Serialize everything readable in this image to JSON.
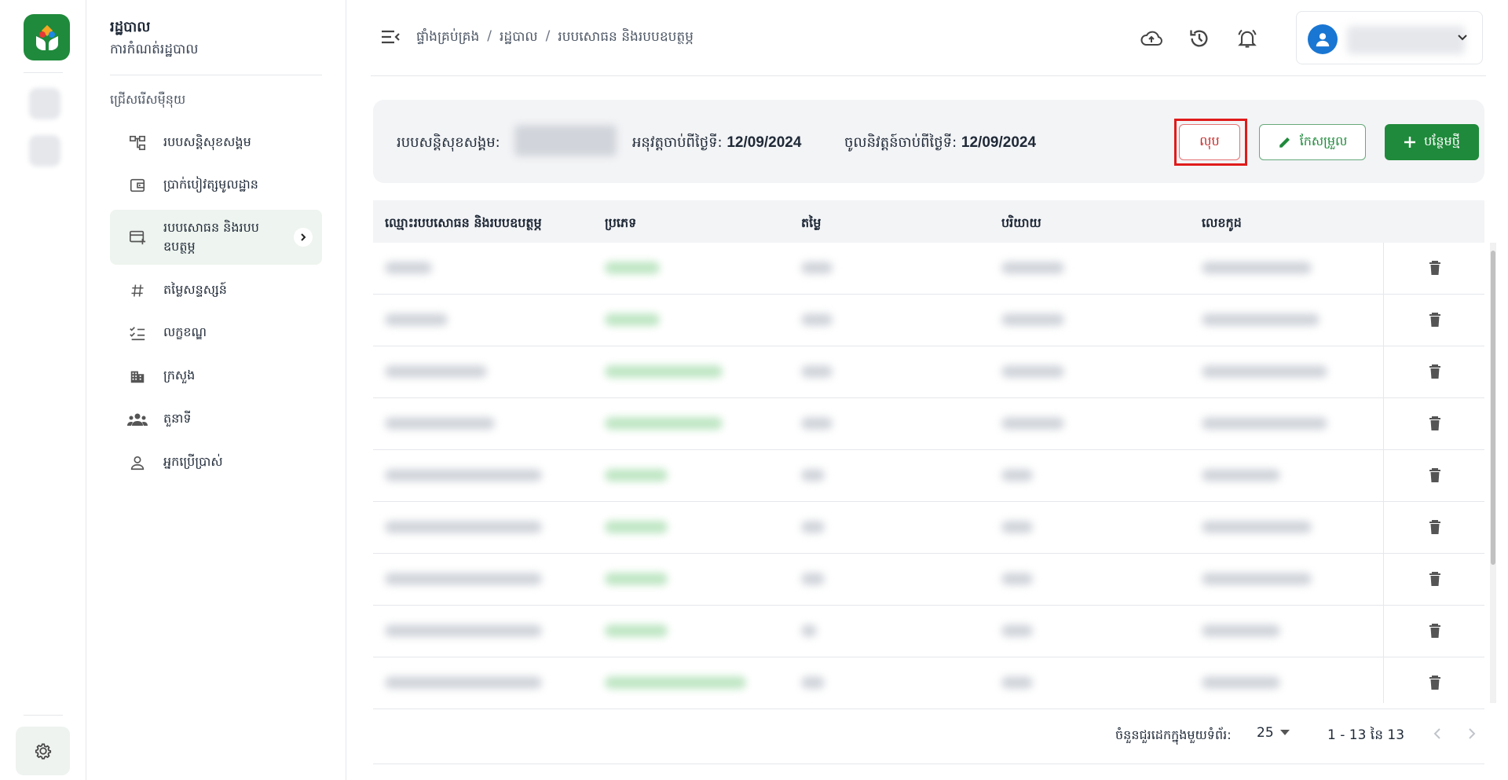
{
  "sidebar_menu": {
    "title": "រដ្ឋបាល",
    "subtitle": "ការកំណត់រដ្ឋបាល",
    "section_label": "ជ្រើសរើសម៉ឺនុយ",
    "items": [
      {
        "label": "របបសន្តិសុខសង្គម",
        "icon": "hierarchy-icon"
      },
      {
        "label": "ប្រាក់បៀវត្សមូលដ្ឋាន",
        "icon": "wallet-icon"
      },
      {
        "label": "របបសោធន និងរបបឧបត្ថម្ភ",
        "icon": "card-add-icon",
        "active": true
      },
      {
        "label": "តម្លៃសន្ទស្សន៍",
        "icon": "hash-icon"
      },
      {
        "label": "លក្ខខណ្ឌ",
        "icon": "checklist-icon"
      },
      {
        "label": "ក្រសួង",
        "icon": "building-icon"
      },
      {
        "label": "តួនាទី",
        "icon": "group-icon"
      },
      {
        "label": "អ្នកប្រើប្រាស់",
        "icon": "person-icon"
      }
    ]
  },
  "header": {
    "breadcrumb": [
      "ផ្ទាំងគ្រប់គ្រង",
      "រដ្ឋបាល",
      "របបសោធន និងរបបឧបត្ថម្ភ"
    ],
    "separator": "/",
    "icons": [
      "cloud-upload-icon",
      "history-icon",
      "bell-icon"
    ]
  },
  "info_bar": {
    "scheme_label": "របបសន្តិសុខសង្គម:",
    "effective_label": "អនុវត្តចាប់ពីថ្ងៃទី:",
    "effective_date": "12/09/2024",
    "enforce_label": "ចូលនិវត្តន៍ចាប់ពីថ្ងៃទី:",
    "enforce_date": "12/09/2024",
    "delete_label": "លុប",
    "edit_label": "កែសម្រួល",
    "add_label": "បន្ថែមថ្មី"
  },
  "table": {
    "columns": [
      "ឈ្មោះរបបសោធន និងរបបឧបត្ថម្ភ",
      "ប្រភេទ",
      "តម្លៃ",
      "បរិយាយ",
      "លេខកូដ"
    ]
  },
  "pagination": {
    "rows_per_page_label": "ចំនួនជួរដេកក្នុងមួយទំព័រ:",
    "rows_per_page": "25",
    "range": "1 - 13 នៃ 13"
  },
  "colors": {
    "brand_green": "#1f8a3b",
    "delete_red": "#c62828",
    "highlight_red": "#e01b1b",
    "avatar_blue": "#1976d2"
  }
}
